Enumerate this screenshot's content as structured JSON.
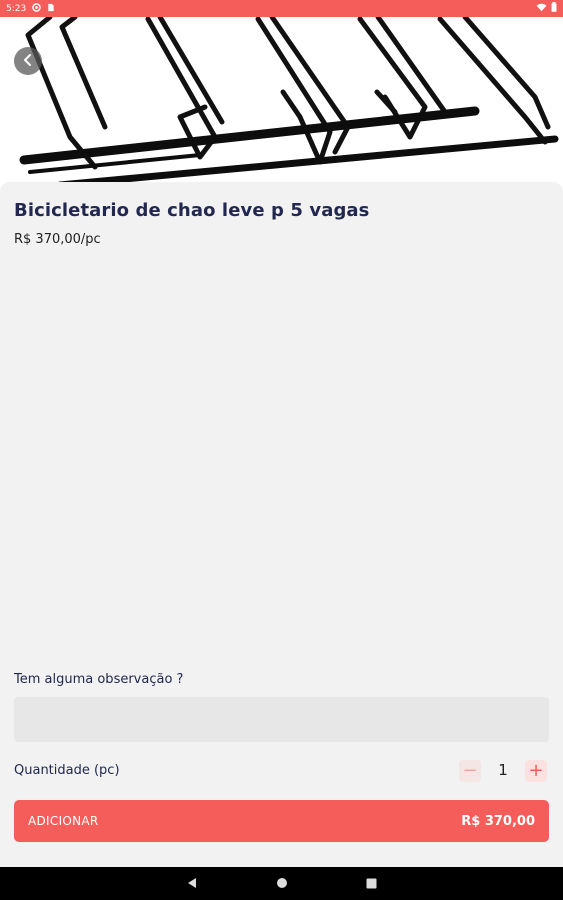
{
  "status_bar": {
    "time": "5:23"
  },
  "product": {
    "title": "Bicicletario de chao leve p 5 vagas",
    "price_label": "R$ 370,00/pc"
  },
  "observation": {
    "label": "Tem alguma observação ?",
    "value": "",
    "placeholder": ""
  },
  "quantity": {
    "label": "Quantidade (pc)",
    "value": "1",
    "minus_symbol": "−",
    "plus_symbol": "+"
  },
  "add_button": {
    "label": "ADICIONAR",
    "total": "R$ 370,00"
  },
  "colors": {
    "accent": "#f45d59",
    "title": "#22284f",
    "background": "#f2f2f2"
  },
  "icons": {
    "back": "chevron-left-icon",
    "wifi": "wifi-icon",
    "battery": "battery-icon",
    "nav_back": "triangle-back-icon",
    "nav_home": "circle-home-icon",
    "nav_recents": "square-recents-icon"
  }
}
